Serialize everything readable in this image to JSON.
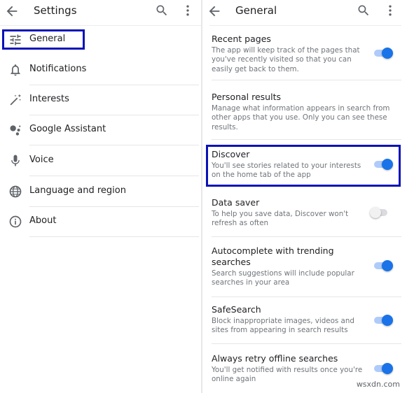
{
  "left": {
    "title": "Settings",
    "items": [
      {
        "label": "General",
        "icon": "tune-icon"
      },
      {
        "label": "Notifications",
        "icon": "bell-icon"
      },
      {
        "label": "Interests",
        "icon": "magic-wand-icon"
      },
      {
        "label": "Google Assistant",
        "icon": "google-assistant-icon"
      },
      {
        "label": "Voice",
        "icon": "microphone-icon"
      },
      {
        "label": "Language and region",
        "icon": "globe-icon"
      },
      {
        "label": "About",
        "icon": "info-icon"
      }
    ]
  },
  "right": {
    "title": "General",
    "settings": [
      {
        "title": "Recent pages",
        "desc": "The app will keep track of the pages that you've recently visited so that you can easily get back to them.",
        "toggle": "on"
      },
      {
        "title": "Personal results",
        "desc": "Manage what information appears in search from other apps that you use. Only you can see these results.",
        "toggle": "none"
      },
      {
        "title": "Discover",
        "desc": "You'll see stories related to your interests on the home tab of the app",
        "toggle": "on"
      },
      {
        "title": "Data saver",
        "desc": "To help you save data, Discover won't refresh as often",
        "toggle": "off"
      },
      {
        "title": "Autocomplete with trending searches",
        "desc": "Search suggestions will include popular searches in your area",
        "toggle": "on"
      },
      {
        "title": "SafeSearch",
        "desc": "Block inappropriate images, videos and sites from appearing in search results",
        "toggle": "on"
      },
      {
        "title": "Always retry offline searches",
        "desc": "You'll get notified with results once you're online again",
        "toggle": "on"
      }
    ]
  },
  "colors": {
    "accent": "#1a73e8",
    "highlight": "#0a12b8"
  },
  "watermark": "wsxdn.com"
}
